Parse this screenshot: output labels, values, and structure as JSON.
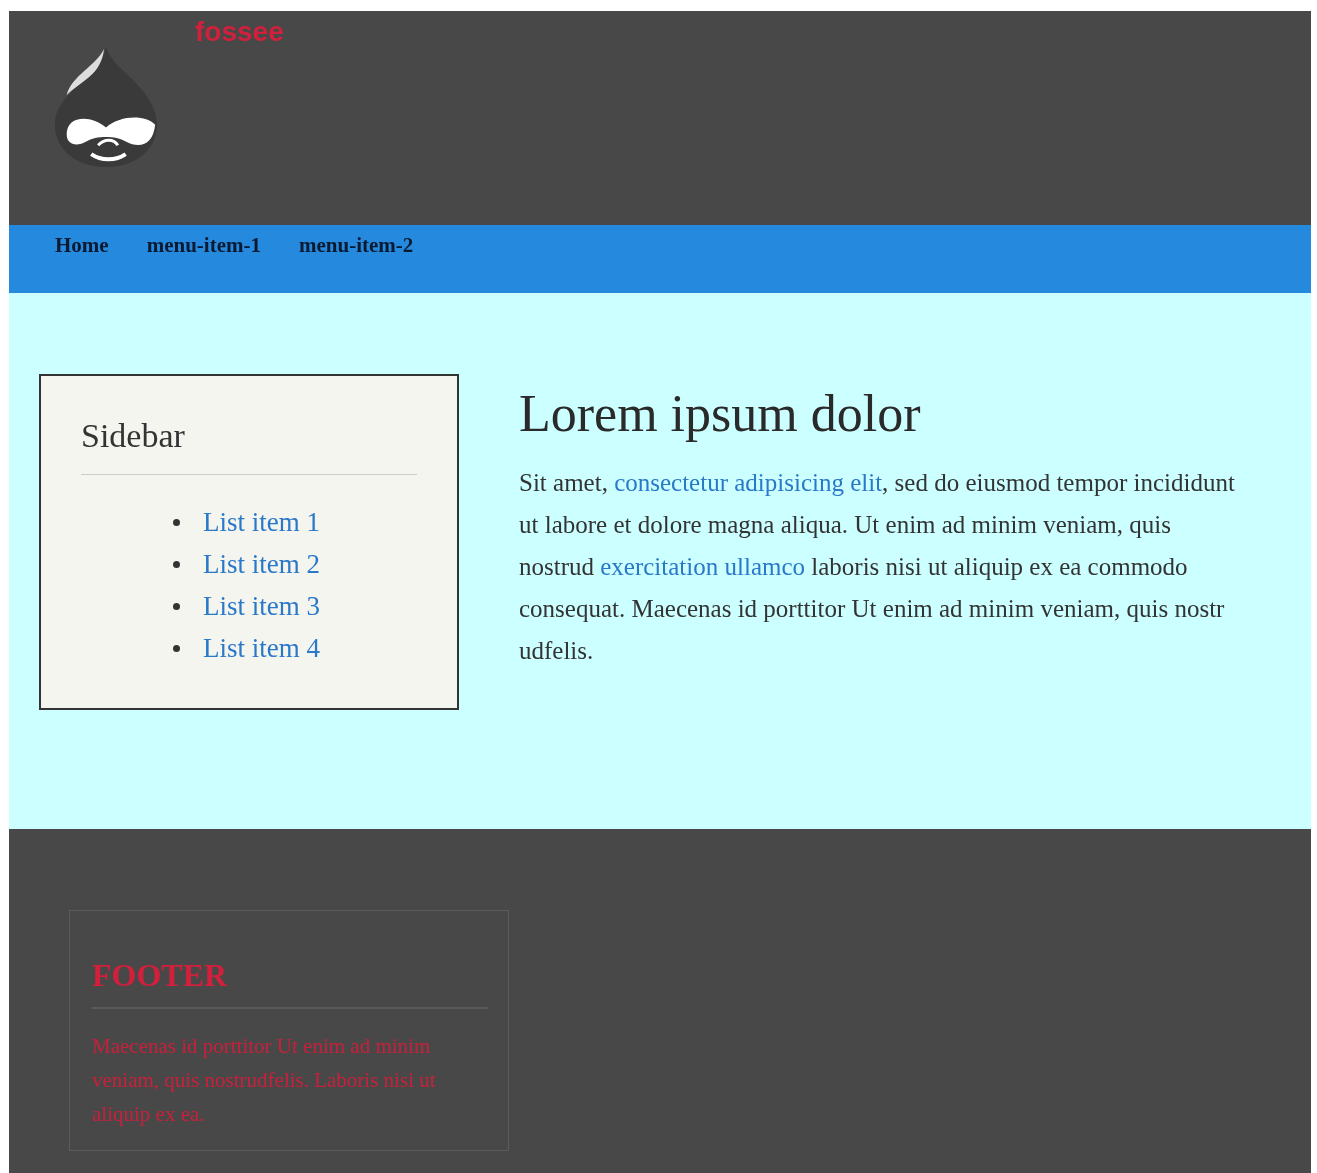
{
  "header": {
    "site_name": "fossee"
  },
  "nav": {
    "items": [
      {
        "label": "Home"
      },
      {
        "label": "menu-item-1"
      },
      {
        "label": "menu-item-2"
      }
    ]
  },
  "sidebar": {
    "title": "Sidebar",
    "items": [
      {
        "label": "List item 1"
      },
      {
        "label": "List item 2"
      },
      {
        "label": "List item 3"
      },
      {
        "label": "List item 4"
      }
    ]
  },
  "article": {
    "title": "Lorem ipsum dolor",
    "paragraph": [
      {
        "kind": "text",
        "text": "Sit amet, "
      },
      {
        "kind": "link",
        "text": "consectetur adipisicing elit"
      },
      {
        "kind": "text",
        "text": ", sed do eiusmod tempor incididunt ut labore et dolore magna aliqua. Ut enim ad minim veniam, quis nostrud "
      },
      {
        "kind": "link",
        "text": "exercitation ullamco"
      },
      {
        "kind": "text",
        "text": " laboris nisi ut aliquip ex ea commodo consequat. Maecenas id porttitor Ut enim ad minim veniam, quis nostr udfelis."
      }
    ]
  },
  "footer": {
    "title": "FOOTER",
    "text": "Maecenas id porttitor Ut enim ad minim veniam, quis nostrudfelis. Laboris nisi ut aliquip ex ea."
  }
}
